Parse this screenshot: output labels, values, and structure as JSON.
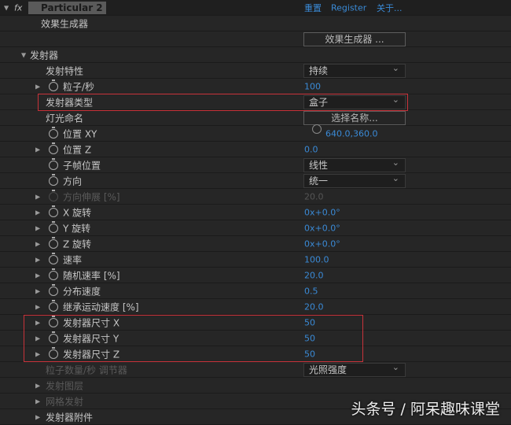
{
  "header": {
    "effect_name": "Particular 2",
    "fx_label": "fx",
    "links": [
      "重置",
      "Register",
      "关于..."
    ]
  },
  "rows": [
    {
      "label": "效果生成器",
      "indent": 52,
      "kind": "group-label"
    },
    {
      "label": "",
      "indent": 0,
      "kind": "button",
      "value": "效果生成器 ..."
    },
    {
      "label": "发射器",
      "indent": 38,
      "arrow": 27,
      "kind": "section"
    },
    {
      "label": "发射特性",
      "indent": 58,
      "kind": "dropdown",
      "value": "持续"
    },
    {
      "label": "粒子/秒",
      "indent": 80,
      "arrow": 45,
      "sw": true,
      "kind": "number",
      "value": "100"
    },
    {
      "label": "发射器类型",
      "indent": 58,
      "kind": "dropdown",
      "value": "盒子"
    },
    {
      "label": "灯光命名",
      "indent": 58,
      "kind": "button",
      "value": "选择名称..."
    },
    {
      "label": "位置 XY",
      "indent": 80,
      "sw": true,
      "kind": "point",
      "value": "640.0,360.0"
    },
    {
      "label": "位置 Z",
      "indent": 80,
      "arrow": 45,
      "sw": true,
      "kind": "number",
      "value": "0.0"
    },
    {
      "label": "子帧位置",
      "indent": 80,
      "sw": true,
      "kind": "dropdown",
      "value": "线性"
    },
    {
      "label": "方向",
      "indent": 80,
      "sw": true,
      "kind": "dropdown",
      "value": "统一"
    },
    {
      "label": "方向伸展 [%]",
      "indent": 80,
      "arrow": 45,
      "sw": true,
      "kind": "number",
      "value": "20.0",
      "disabled": true
    },
    {
      "label": "X 旋转",
      "indent": 80,
      "arrow": 45,
      "sw": true,
      "kind": "number",
      "value": "0x+0.0°"
    },
    {
      "label": "Y 旋转",
      "indent": 80,
      "arrow": 45,
      "sw": true,
      "kind": "number",
      "value": "0x+0.0°"
    },
    {
      "label": "Z 旋转",
      "indent": 80,
      "arrow": 45,
      "sw": true,
      "kind": "number",
      "value": "0x+0.0°"
    },
    {
      "label": "速率",
      "indent": 80,
      "arrow": 45,
      "sw": true,
      "kind": "number",
      "value": "100.0"
    },
    {
      "label": "随机速率 [%]",
      "indent": 80,
      "arrow": 45,
      "sw": true,
      "kind": "number",
      "value": "20.0"
    },
    {
      "label": "分布速度",
      "indent": 80,
      "arrow": 45,
      "sw": true,
      "kind": "number",
      "value": "0.5"
    },
    {
      "label": "继承运动速度 [%]",
      "indent": 80,
      "arrow": 45,
      "sw": true,
      "kind": "number",
      "value": "20.0"
    },
    {
      "label": "发射器尺寸 X",
      "indent": 80,
      "arrow": 45,
      "sw": true,
      "kind": "number",
      "value": "50"
    },
    {
      "label": "发射器尺寸 Y",
      "indent": 80,
      "arrow": 45,
      "sw": true,
      "kind": "number",
      "value": "50"
    },
    {
      "label": "发射器尺寸 Z",
      "indent": 80,
      "arrow": 45,
      "sw": true,
      "kind": "number",
      "value": "50"
    },
    {
      "label": "粒子数量/秒 调节器",
      "indent": 58,
      "kind": "dropdown",
      "value": "光照强度",
      "disabled": true
    },
    {
      "label": "发射图层",
      "indent": 58,
      "arrow": 45,
      "kind": "section",
      "disabled": true
    },
    {
      "label": "网格发射",
      "indent": 58,
      "arrow": 45,
      "kind": "section",
      "disabled": true
    },
    {
      "label": "发射器附件",
      "indent": 58,
      "arrow": 45,
      "kind": "section"
    }
  ],
  "watermark": "头条号 / 阿呆趣味课堂",
  "colors": {
    "value_blue": "#3a8ad6",
    "highlight_red": "#c8323a"
  }
}
